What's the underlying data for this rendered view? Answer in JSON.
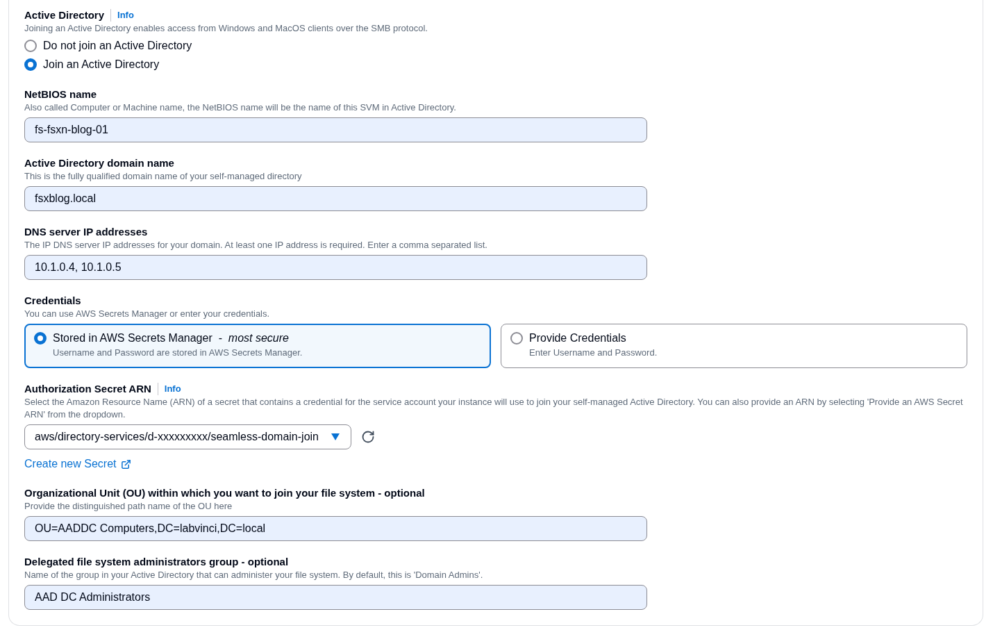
{
  "sections": [
    {
      "kind": "radio_group",
      "label": "Active Directory",
      "info": "Info",
      "description": "Joining an Active Directory enables access from Windows and MacOS clients over the SMB protocol.",
      "options": [
        {
          "label": "Do not join an Active Directory",
          "selected": false
        },
        {
          "label": "Join an Active Directory",
          "selected": true
        }
      ]
    },
    {
      "kind": "text_input",
      "label": "NetBIOS name",
      "description": "Also called Computer or Machine name, the NetBIOS name will be the name of this SVM in Active Directory.",
      "value": "fs-fsxn-blog-01"
    },
    {
      "kind": "text_input",
      "label": "Active Directory domain name",
      "description": "This is the fully qualified domain name of your self-managed directory",
      "value": "fsxblog.local"
    },
    {
      "kind": "text_input",
      "label": "DNS server IP addresses",
      "description": "The IP DNS server IP addresses for your domain. At least one IP address is required. Enter a comma separated list.",
      "value": "10.1.0.4, 10.1.0.5"
    },
    {
      "kind": "tiles",
      "label": "Credentials",
      "description": "You can use AWS Secrets Manager or enter your credentials.",
      "options": [
        {
          "title": "Stored in AWS Secrets Manager  -  *most secure*",
          "description": "Username and Password are stored in AWS Secrets Manager.",
          "selected": true
        },
        {
          "title": "Provide Credentials",
          "description": "Enter Username and Password.",
          "selected": false
        }
      ]
    },
    {
      "kind": "select",
      "label": "Authorization Secret ARN",
      "info": "Info",
      "description": "Select the Amazon Resource Name (ARN) of a secret that contains a credential for the service account your instance will use to join your self-managed Active Directory. You can also provide an ARN by selecting 'Provide an AWS Secret ARN' from the dropdown.",
      "value": "aws/directory-services/d-xxxxxxxxx/seamless-domain-join",
      "link": "Create new Secret"
    },
    {
      "kind": "text_input",
      "label": "Organizational Unit (OU) within which you want to join your file system - optional",
      "description": "Provide the distinguished path name of the OU here",
      "value": "OU=AADDC Computers,DC=labvinci,DC=local"
    },
    {
      "kind": "text_input",
      "label": "Delegated file system administrators group - optional",
      "description": "Name of the group in your Active Directory that can administer your file system. By default, this is 'Domain Admins'.",
      "value": "AAD DC Administrators"
    }
  ]
}
